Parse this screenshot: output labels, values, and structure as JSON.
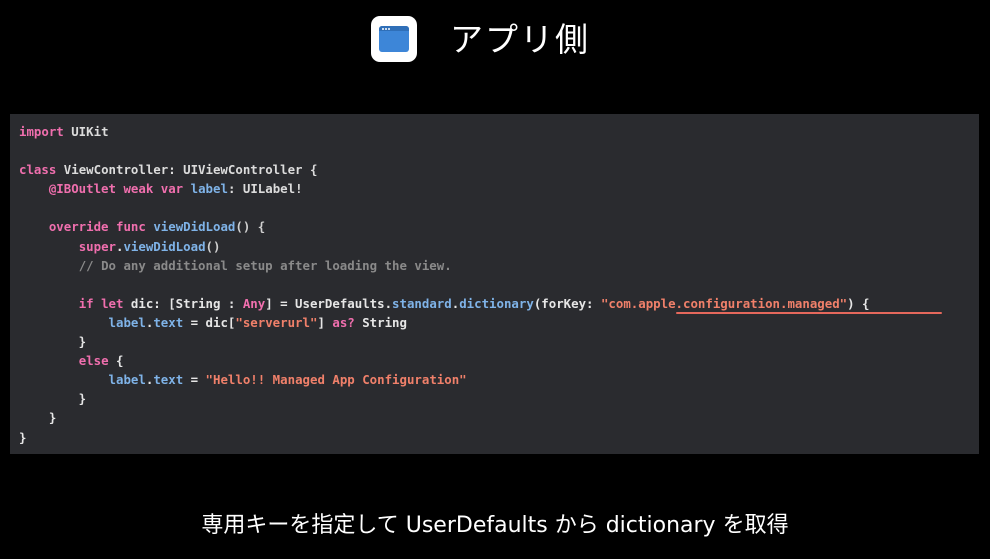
{
  "header": {
    "icon": "app-window-icon",
    "title": "アプリ側",
    "icon_colors": {
      "frame": "#ffffff",
      "window": "#3d86d8"
    }
  },
  "code": {
    "lines": [
      [
        {
          "t": "import",
          "c": "kw"
        },
        {
          "t": " UIKit",
          "c": "type"
        }
      ],
      [],
      [
        {
          "t": "class",
          "c": "kw"
        },
        {
          "t": " ViewController",
          "c": "type"
        },
        {
          "t": ": UIViewController {",
          "c": "type"
        }
      ],
      [
        {
          "t": "    "
        },
        {
          "t": "@IBOutlet",
          "c": "attr"
        },
        {
          "t": " "
        },
        {
          "t": "weak",
          "c": "kw"
        },
        {
          "t": " "
        },
        {
          "t": "var",
          "c": "kw"
        },
        {
          "t": " "
        },
        {
          "t": "label",
          "c": "prop"
        },
        {
          "t": ": UILabel!",
          "c": "type"
        }
      ],
      [],
      [
        {
          "t": "    "
        },
        {
          "t": "override",
          "c": "kw"
        },
        {
          "t": " "
        },
        {
          "t": "func",
          "c": "kw"
        },
        {
          "t": " "
        },
        {
          "t": "viewDidLoad",
          "c": "prop"
        },
        {
          "t": "() {",
          "c": "fn"
        }
      ],
      [
        {
          "t": "        "
        },
        {
          "t": "super",
          "c": "kw"
        },
        {
          "t": "."
        },
        {
          "t": "viewDidLoad",
          "c": "prop"
        },
        {
          "t": "()",
          "c": "fn"
        }
      ],
      [
        {
          "t": "        "
        },
        {
          "t": "// Do any additional setup after loading the view.",
          "c": "cm"
        }
      ],
      [],
      [
        {
          "t": "        "
        },
        {
          "t": "if",
          "c": "kw"
        },
        {
          "t": " "
        },
        {
          "t": "let",
          "c": "kw"
        },
        {
          "t": " dic: [String : "
        },
        {
          "t": "Any",
          "c": "kw"
        },
        {
          "t": "] = UserDefaults."
        },
        {
          "t": "standard",
          "c": "prop"
        },
        {
          "t": "."
        },
        {
          "t": "dictionary",
          "c": "prop"
        },
        {
          "t": "(forKey: "
        },
        {
          "t": "\"com.apple.configuration.managed\"",
          "c": "str"
        },
        {
          "t": ") {"
        }
      ],
      [
        {
          "t": "            "
        },
        {
          "t": "label",
          "c": "prop"
        },
        {
          "t": "."
        },
        {
          "t": "text",
          "c": "prop"
        },
        {
          "t": " = dic["
        },
        {
          "t": "\"serverurl\"",
          "c": "str"
        },
        {
          "t": "] "
        },
        {
          "t": "as?",
          "c": "kw"
        },
        {
          "t": " String"
        }
      ],
      [
        {
          "t": "        }"
        }
      ],
      [
        {
          "t": "        "
        },
        {
          "t": "else",
          "c": "kw"
        },
        {
          "t": " {"
        }
      ],
      [
        {
          "t": "            "
        },
        {
          "t": "label",
          "c": "prop"
        },
        {
          "t": "."
        },
        {
          "t": "text",
          "c": "prop"
        },
        {
          "t": " = "
        },
        {
          "t": "\"Hello!! Managed App Configuration\"",
          "c": "str"
        }
      ],
      [
        {
          "t": "        }"
        }
      ],
      [
        {
          "t": "    }"
        }
      ],
      [
        {
          "t": "}"
        }
      ]
    ],
    "colors": {
      "background": "#2a2b2f",
      "keyword": "#f06fae",
      "property": "#7fb3e8",
      "string": "#f0806a",
      "comment": "#8a8a8a",
      "underline": "#e5685c"
    }
  },
  "caption": "専用キーを指定して UserDefaults から dictionary を取得"
}
